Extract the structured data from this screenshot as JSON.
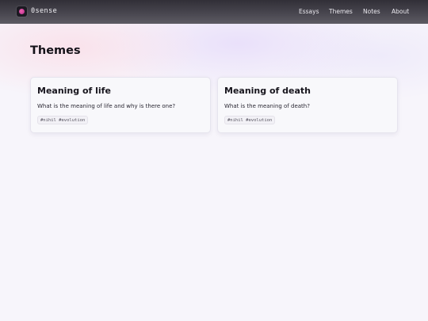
{
  "site": {
    "name": "0sense"
  },
  "nav": {
    "items": [
      "Essays",
      "Themes",
      "Notes",
      "About"
    ]
  },
  "page": {
    "title": "Themes"
  },
  "cards": [
    {
      "title": "Meaning of life",
      "description": "What is the meaning of life and why is there one?",
      "tags": "#nihil #evolution"
    },
    {
      "title": "Meaning of death",
      "description": "What is the meaning of death?",
      "tags": "#nihil #evolution"
    }
  ],
  "colors": {
    "header": "#3a3840",
    "background": "#f7f5fb",
    "logo_accent": "#d43f9e"
  }
}
